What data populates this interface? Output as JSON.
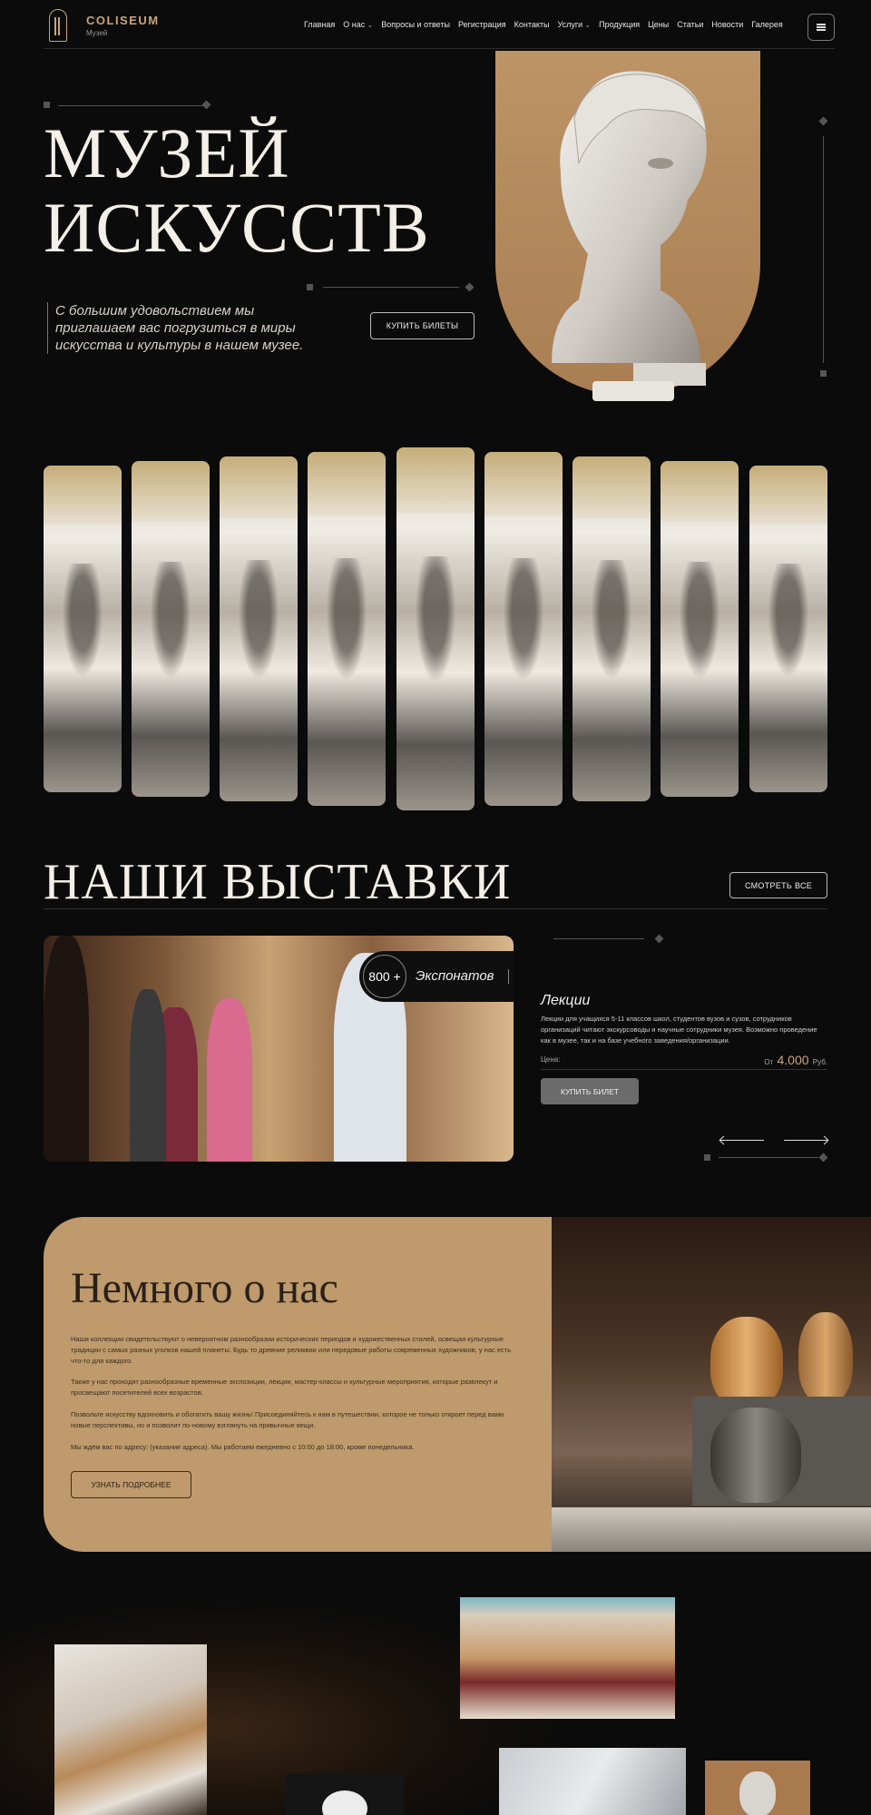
{
  "brand": {
    "name": "COLISEUM",
    "subtitle": "Музей"
  },
  "nav": {
    "items": [
      "Главная",
      "О нас",
      "Вопросы и ответы",
      "Регистрация",
      "Контакты",
      "Услуги",
      "Продукция",
      "Цены",
      "Статьи",
      "Новости",
      "Галерея"
    ],
    "menu_icon": "hamburger-icon"
  },
  "hero": {
    "title_line1": "МУЗЕЙ",
    "title_line2": "ИСКУССТВ",
    "text": "С большим удовольствием мы приглашаем вас погрузиться в миры искусства и культуры в нашем музее.",
    "buy_button": "КУПИТЬ БИЛЕТЫ",
    "accent_color": "#bd9466"
  },
  "exhibitions": {
    "title": "НАШИ ВЫСТАВКИ",
    "view_all": "СМОТРЕТЬ ВСЕ",
    "badge_number": "800 +",
    "badge_text": "Экспонатов",
    "item_title": "Лекции",
    "item_desc": "Лекции для учащихся 5-11 классов школ, студентов вузов и сузов, сотрудников организаций читают экскурсоводы и научные сотрудники музея. Возможно проведение как в музее, так и на базе учебного заведения/организации.",
    "price_label": "Цена:",
    "price_prefix": "От",
    "price_value": "4.000",
    "price_currency": "Руб.",
    "buy_button": "КУПИТЬ БИЛЕТ"
  },
  "about": {
    "title": "Немного о нас",
    "p1": "Наши коллекции свидетельствуют о невероятном разнообразии исторических периодов и художественных стилей, освещая культурные традиции с самых разных уголков нашей планеты. Будь то древние реликвии или передовые работы современных художников, у нас есть что-то для каждого.",
    "p2": "Также у нас проходят разнообразные временные экспозиции, лекции, мастер-классы и культурные мероприятия, которые развлекут и просвещают посетителей всех возрастов.",
    "p3": "Позвольте искусству вдохновить и обогатить вашу жизнь! Присоединяйтесь к нам в путешествии, которое не только откроет перед вами новые перспективы, но и позволит по-новому взглянуть на привычные вещи.",
    "p4": "Мы ждём вас по адресу: (указание адреса). Мы работаем ежедневно с 10:00 до 18:00, кроме понедельника.",
    "button": "УЗНАТЬ ПОДРОБНЕЕ",
    "bg_color": "#be9a6c"
  }
}
